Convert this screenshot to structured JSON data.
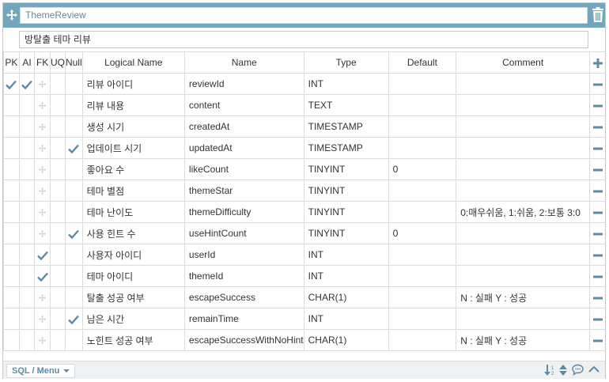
{
  "table": {
    "name": "ThemeReview",
    "logical_name": "방탈출 테마 리뷰"
  },
  "headers": [
    "PK",
    "AI",
    "FK",
    "UQ",
    "Null",
    "Logical Name",
    "Name",
    "Type",
    "Default",
    "Comment"
  ],
  "columns": [
    {
      "logical": "리뷰 아이디",
      "name": "reviewId",
      "type": "INT",
      "default": "",
      "comment": "",
      "pk": true,
      "ai": true,
      "fk": false,
      "null": false
    },
    {
      "logical": "리뷰 내용",
      "name": "content",
      "type": "TEXT",
      "default": "",
      "comment": "",
      "pk": false,
      "ai": false,
      "fk": false,
      "null": false
    },
    {
      "logical": "생성 시기",
      "name": "createdAt",
      "type": "TIMESTAMP",
      "default": "",
      "comment": "",
      "pk": false,
      "ai": false,
      "fk": false,
      "null": false
    },
    {
      "logical": "업데이트 시기",
      "name": "updatedAt",
      "type": "TIMESTAMP",
      "default": "",
      "comment": "",
      "pk": false,
      "ai": false,
      "fk": false,
      "null": true
    },
    {
      "logical": "좋아요 수",
      "name": "likeCount",
      "type": "TINYINT",
      "default": "0",
      "comment": "",
      "pk": false,
      "ai": false,
      "fk": false,
      "null": false
    },
    {
      "logical": "테마 별점",
      "name": "themeStar",
      "type": "TINYINT",
      "default": "",
      "comment": "",
      "pk": false,
      "ai": false,
      "fk": false,
      "null": false
    },
    {
      "logical": "테마 난이도",
      "name": "themeDifficulty",
      "type": "TINYINT",
      "default": "",
      "comment": "0:매우쉬움, 1:쉬움, 2:보통 3:0",
      "pk": false,
      "ai": false,
      "fk": false,
      "null": false
    },
    {
      "logical": "사용 힌트 수",
      "name": "useHintCount",
      "type": "TINYINT",
      "default": "0",
      "comment": "",
      "pk": false,
      "ai": false,
      "fk": false,
      "null": true
    },
    {
      "logical": "사용자 아이디",
      "name": "userId",
      "type": "INT",
      "default": "",
      "comment": "",
      "pk": false,
      "ai": false,
      "fk": true,
      "null": false
    },
    {
      "logical": "테마 아이디",
      "name": "themeId",
      "type": "INT",
      "default": "",
      "comment": "",
      "pk": false,
      "ai": false,
      "fk": true,
      "null": false
    },
    {
      "logical": "탈출 성공 여부",
      "name": "escapeSuccess",
      "type": "CHAR(1)",
      "default": "",
      "comment": "N : 실패 Y : 성공",
      "pk": false,
      "ai": false,
      "fk": false,
      "null": false
    },
    {
      "logical": "남은 시간",
      "name": "remainTime",
      "type": "INT",
      "default": "",
      "comment": "",
      "pk": false,
      "ai": false,
      "fk": false,
      "null": true
    },
    {
      "logical": "노힌트 성공 여부",
      "name": "escapeSuccessWithNoHint",
      "type": "CHAR(1)",
      "default": "",
      "comment": "N : 실패 Y : 성공",
      "pk": false,
      "ai": false,
      "fk": false,
      "null": false
    }
  ],
  "footer": {
    "sql_menu_label": "SQL / Menu"
  },
  "icons": {
    "move": "move-icon",
    "trash": "trash-icon",
    "add_column": "plus-icon",
    "remove_column": "minus-icon",
    "check": "check-icon",
    "sort": "sort-icon",
    "comment": "comment-icon",
    "collapse": "chevron-up-icon"
  },
  "colors": {
    "header_bar": "#73a6be",
    "icon": "#5c8ba3",
    "check": "#5c8ba3",
    "move_handle": "#d2d6d8"
  }
}
